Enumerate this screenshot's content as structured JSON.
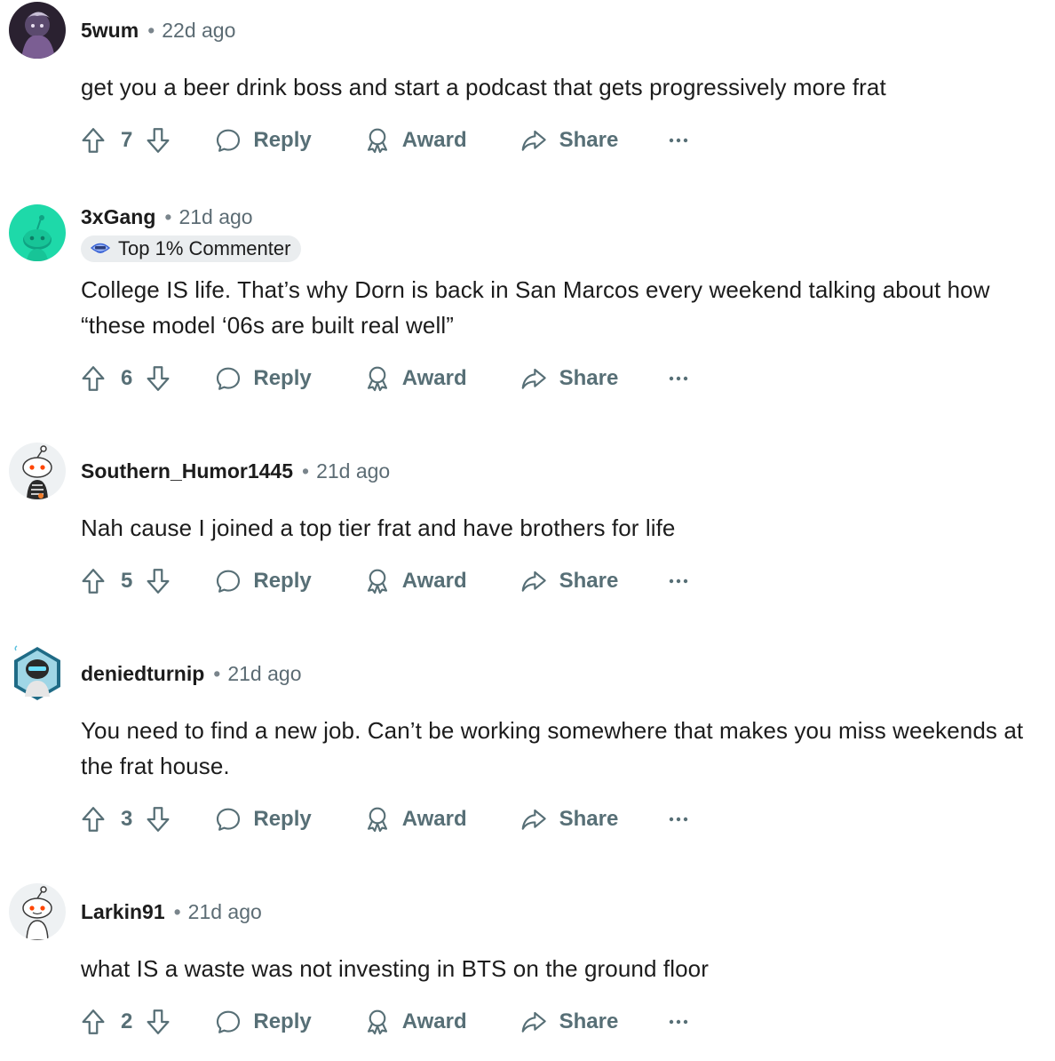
{
  "comments": [
    {
      "username": "5wum",
      "time": "22d ago",
      "flair": "",
      "body": "get you a beer drink boss and start a podcast that gets progressively more frat",
      "votes": "7"
    },
    {
      "username": "3xGang",
      "time": "21d ago",
      "flair": "Top 1% Commenter",
      "body": "College IS life. That’s why Dorn is back in San Marcos every weekend talking about how “these model ‘06s are built real well”",
      "votes": "6"
    },
    {
      "username": "Southern_Humor1445",
      "time": "21d ago",
      "flair": "",
      "body": "Nah cause I joined a top tier frat and have brothers for life",
      "votes": "5"
    },
    {
      "username": "deniedturnip",
      "time": "21d ago",
      "flair": "",
      "body": "You need to find a new job. Can’t be working somewhere that makes you miss weekends at the frat house.",
      "votes": "3"
    },
    {
      "username": "Larkin91",
      "time": "21d ago",
      "flair": "",
      "body": "what IS a waste was not investing in BTS on the ground floor",
      "votes": "2"
    }
  ],
  "actions": {
    "reply": "Reply",
    "award": "Award",
    "share": "Share"
  },
  "meta": {
    "separator": "•"
  },
  "icons": [
    "upvote-icon",
    "downvote-icon",
    "reply-icon",
    "award-icon",
    "share-icon",
    "more-icon"
  ],
  "colors": {
    "text": "#1c1c1c",
    "muted": "#576f76",
    "timestamp": "#5c6c74",
    "flair_bg": "#eaedef",
    "avatar_green": "#1ed9a9"
  }
}
